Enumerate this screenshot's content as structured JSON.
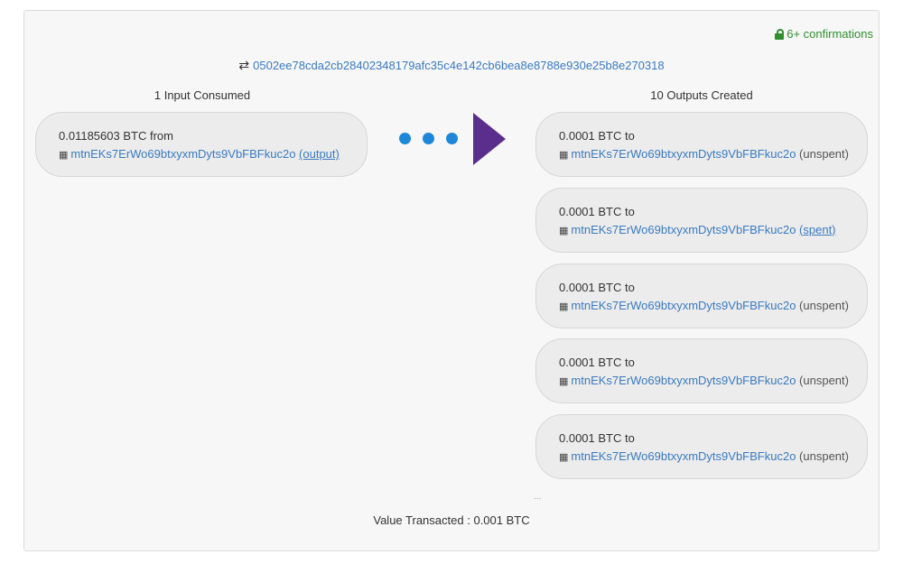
{
  "confirmations": {
    "label": "6+ confirmations",
    "color": "#2f8f2f"
  },
  "tx": {
    "id": "0502ee78cda2cb28402348179afc35c4e142cb6bea8e8788e930e25b8e270318"
  },
  "inputs": {
    "header": "1 Input Consumed",
    "items": [
      {
        "amount": "0.01185603 BTC",
        "dir": "from",
        "address": "mtnEKs7ErWo69btxyxmDyts9VbFBFkuc2o",
        "status": "(output)",
        "status_link": true
      }
    ]
  },
  "outputs": {
    "header": "10 Outputs Created",
    "items": [
      {
        "amount": "0.0001 BTC",
        "dir": "to",
        "address": "mtnEKs7ErWo69btxyxmDyts9VbFBFkuc2o",
        "status": "(unspent)",
        "status_link": false
      },
      {
        "amount": "0.0001 BTC",
        "dir": "to",
        "address": "mtnEKs7ErWo69btxyxmDyts9VbFBFkuc2o",
        "status": "(spent)",
        "status_link": true
      },
      {
        "amount": "0.0001 BTC",
        "dir": "to",
        "address": "mtnEKs7ErWo69btxyxmDyts9VbFBFkuc2o",
        "status": "(unspent)",
        "status_link": false
      },
      {
        "amount": "0.0001 BTC",
        "dir": "to",
        "address": "mtnEKs7ErWo69btxyxmDyts9VbFBFkuc2o",
        "status": "(unspent)",
        "status_link": false
      },
      {
        "amount": "0.0001 BTC",
        "dir": "to",
        "address": "mtnEKs7ErWo69btxyxmDyts9VbFBFkuc2o",
        "status": "(unspent)",
        "status_link": false
      }
    ],
    "more": "..."
  },
  "summary": {
    "label": "Value Transacted",
    "separator": ":",
    "value": "0.001 BTC"
  },
  "colors": {
    "link": "#3a7ac0",
    "dots": "#1e87d9",
    "arrow": "#5b2d8c"
  },
  "icons": {
    "lock": "lock-icon",
    "swap": "swap-arrows-icon",
    "qr": "qr-code-icon"
  }
}
